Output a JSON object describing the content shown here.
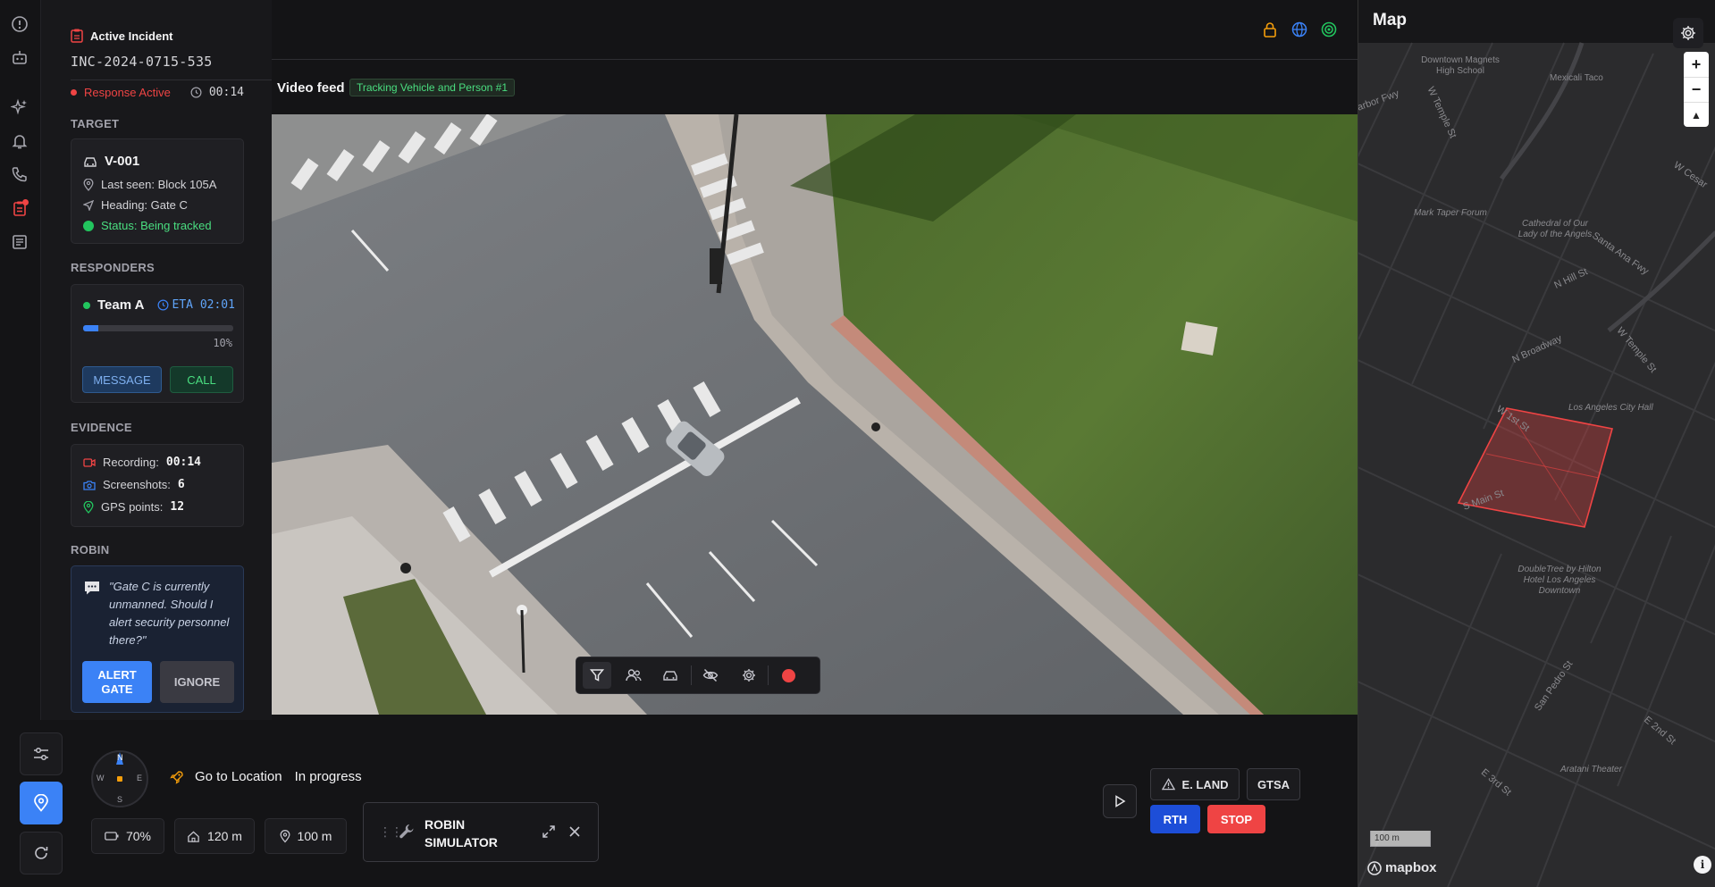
{
  "incident": {
    "header": "Active Incident",
    "id": "INC-2024-0715-535",
    "status": "Response Active",
    "timer": "00:14"
  },
  "target": {
    "section": "TARGET",
    "name": "V-001",
    "last_seen": "Last seen: Block 105A",
    "heading": "Heading: Gate C",
    "status": "Status: Being tracked"
  },
  "responders": {
    "section": "RESPONDERS",
    "team": "Team A",
    "eta": "ETA 02:01",
    "progress_label": "10%",
    "progress": 0.1,
    "message_label": "MESSAGE",
    "call_label": "CALL"
  },
  "evidence": {
    "section": "EVIDENCE",
    "recording_label": "Recording:",
    "recording_value": "00:14",
    "screenshots_label": "Screenshots:",
    "screenshots_value": "6",
    "gps_label": "GPS points:",
    "gps_value": "12"
  },
  "robin": {
    "section": "ROBIN",
    "message": "\"Gate C is currently unmanned. Should I alert security personnel there?\"",
    "alert_label_1": "ALERT",
    "alert_label_2": "GATE",
    "ignore_label": "IGNORE"
  },
  "feed": {
    "title": "Video feed",
    "tracking_badge": "Tracking Vehicle and Person #1"
  },
  "mission": {
    "action": "Go to Location",
    "state": "In progress",
    "battery": "70%",
    "altitude": "120 m",
    "distance": "100 m"
  },
  "compass": {
    "n": "N",
    "s": "S",
    "e": "E",
    "w": "W"
  },
  "simulator": {
    "line1": "ROBIN",
    "line2": "SIMULATOR"
  },
  "controls": {
    "eland_label": "E. LAND",
    "gtsa_label": "GTSA",
    "rth_label": "RTH",
    "stop_label": "STOP"
  },
  "map": {
    "title": "Map",
    "scale": "100 m",
    "attribution": "mapbox",
    "labels": {
      "school": "Downtown Magnets High School",
      "mexicali": "Mexicali Taco",
      "harbor": "Harbor Fwy",
      "wtemple": "W Temple St",
      "wcesar": "W Cesar",
      "mark_taper": "Mark Taper Forum",
      "cathedral": "Cathedral of Our Lady of the Angels",
      "santa_ana": "Santa Ana Fwy",
      "nhill": "N Hill St",
      "nbroadway": "N Broadway",
      "wtemple2": "W Temple St",
      "city_hall": "Los Angeles City Hall",
      "wfirst": "W 1st St",
      "smain": "S Main St",
      "doubletree": "DoubleTree by Hilton Hotel Los Angeles Downtown",
      "san_pedro": "San Pedro St",
      "e2nd": "E 2nd St",
      "e3rd": "E 3rd St",
      "aratani": "Aratani Theater"
    }
  },
  "colors": {
    "accent_blue": "#3b82f6",
    "danger": "#ef4444",
    "success": "#22c55e",
    "warning": "#f59e0b"
  }
}
